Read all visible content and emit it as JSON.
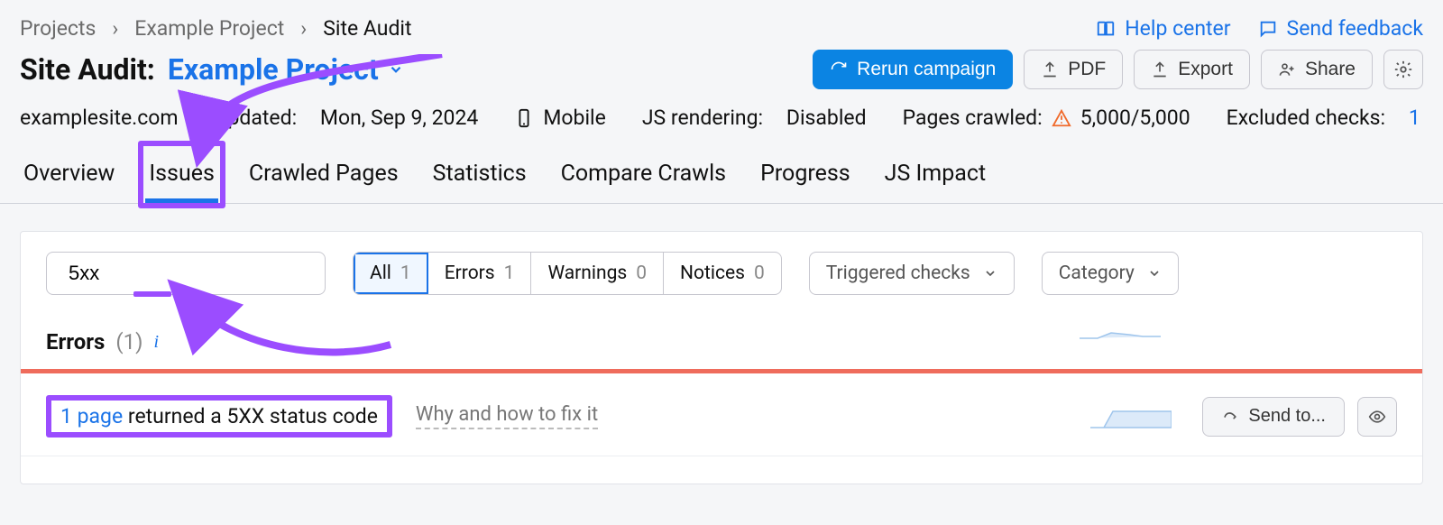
{
  "breadcrumbs": {
    "items": [
      "Projects",
      "Example Project",
      "Site Audit"
    ]
  },
  "top_links": {
    "help": "Help center",
    "feedback": "Send feedback"
  },
  "title": {
    "prefix": "Site Audit:",
    "project": "Example Project"
  },
  "actions": {
    "rerun": "Rerun campaign",
    "pdf": "PDF",
    "export": "Export",
    "share": "Share"
  },
  "meta": {
    "site": "examplesite.com",
    "updated_label": "Updated:",
    "updated_value": "Mon, Sep 9, 2024",
    "device": "Mobile",
    "js_label": "JS rendering:",
    "js_value": "Disabled",
    "crawled_label": "Pages crawled:",
    "crawled_value": "5,000/5,000",
    "excluded_label": "Excluded checks:",
    "excluded_value": "1"
  },
  "tabs": {
    "items": [
      "Overview",
      "Issues",
      "Crawled Pages",
      "Statistics",
      "Compare Crawls",
      "Progress",
      "JS Impact"
    ],
    "active": "Issues"
  },
  "filters": {
    "search_value": "5xx",
    "segments": [
      {
        "label": "All",
        "count": "1"
      },
      {
        "label": "Errors",
        "count": "1"
      },
      {
        "label": "Warnings",
        "count": "0"
      },
      {
        "label": "Notices",
        "count": "0"
      }
    ],
    "triggered": "Triggered checks",
    "category": "Category"
  },
  "errors": {
    "heading": "Errors",
    "count": "(1)",
    "row": {
      "pages": "1 page",
      "rest": " returned a 5XX status code",
      "why": "Why and how to fix it",
      "send": "Send to..."
    }
  }
}
